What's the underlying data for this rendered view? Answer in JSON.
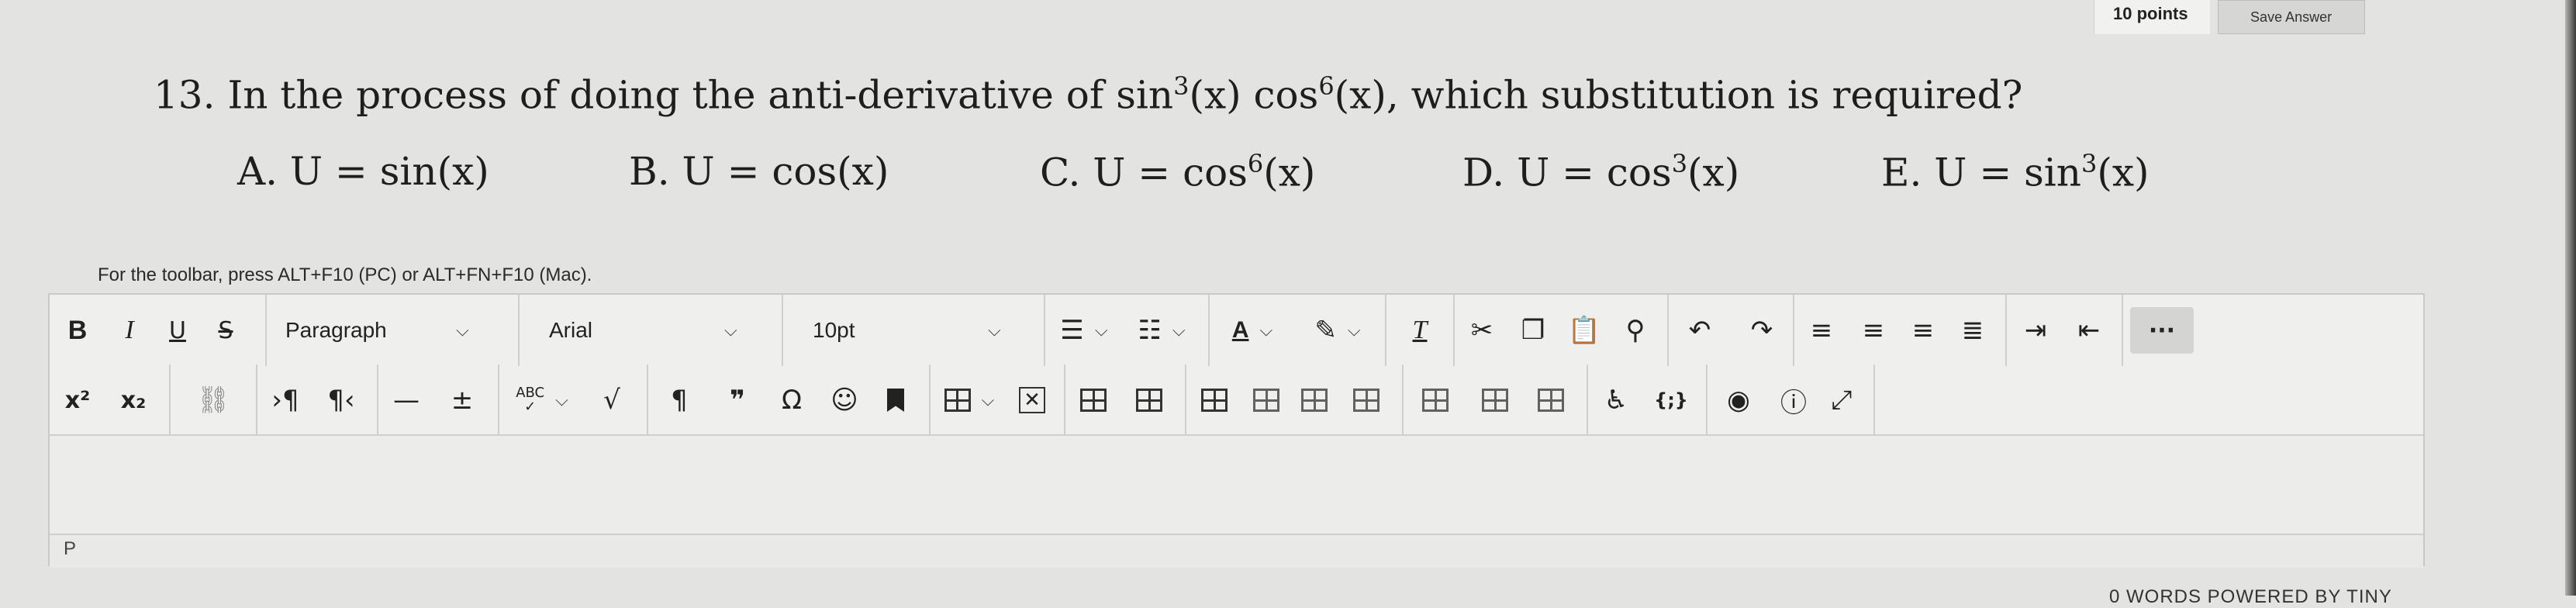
{
  "header": {
    "points": "10 points",
    "save_label": "Save Answer"
  },
  "question": {
    "number": "13.",
    "text_pre": "In the process of doing the anti-derivative of sin",
    "exp1": "3",
    "text_mid": "(x) cos",
    "exp2": "6",
    "text_post": "(x), which substitution is required?",
    "options": {
      "a_pre": "A. U = sin(x)",
      "b_pre": "B. U = cos(x)",
      "c_pre": "C. U = cos",
      "c_exp": "6",
      "c_post": "(x)",
      "d_pre": "D. U = cos",
      "d_exp": "3",
      "d_post": "(x)",
      "e_pre": "E. U = sin",
      "e_exp": "3",
      "e_post": "(x)"
    }
  },
  "editor": {
    "hint": "For the toolbar, press ALT+F10 (PC) or ALT+FN+F10 (Mac).",
    "row1": {
      "bold": "B",
      "italic": "I",
      "underline": "U",
      "strike": "S",
      "format_value": "Paragraph",
      "font_value": "Arial",
      "size_value": "10pt",
      "more": "···"
    },
    "row2": {
      "superscript": "x²",
      "subscript": "x₂",
      "spellcheck_abc": "ABC",
      "paragraph_mark": "¶",
      "quote": "❞",
      "omega": "Ω",
      "code": "{;}"
    },
    "path": "P",
    "words_status": "0 WORDS  POWERED BY TINY"
  },
  "icons": {
    "accent": "#1e1e1e",
    "toolbar_bg": "#efefee"
  }
}
